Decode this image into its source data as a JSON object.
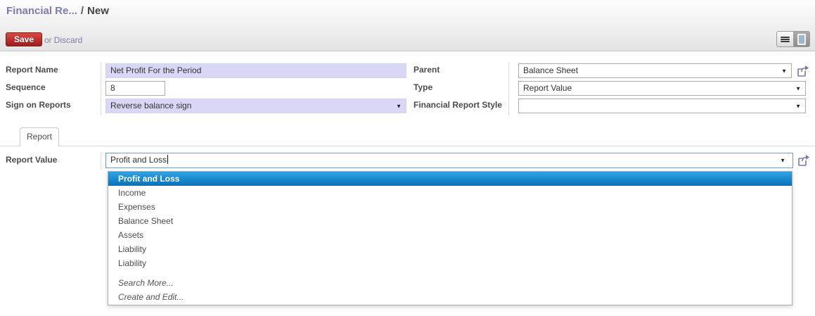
{
  "breadcrumb": {
    "parent": "Financial Re...",
    "separator": "/",
    "current": "New"
  },
  "statusbar": {
    "save_label": "Save",
    "or_label": "or",
    "discard_label": "Discard"
  },
  "view_switcher": {
    "list_tooltip": "List",
    "form_tooltip": "Form"
  },
  "icons": {
    "dropdown_arrow": "▼",
    "list_icon": "list-view",
    "form_icon": "form-view",
    "external_link": "external-link"
  },
  "form": {
    "left": {
      "report_name": {
        "label": "Report Name",
        "value": "Net Profit For the Period"
      },
      "sequence": {
        "label": "Sequence",
        "value": "8"
      },
      "sign_on_reports": {
        "label": "Sign on Reports",
        "value": "Reverse balance sign"
      }
    },
    "right": {
      "parent": {
        "label": "Parent",
        "value": "Balance Sheet"
      },
      "type": {
        "label": "Type",
        "value": "Report Value"
      },
      "financial_report_style": {
        "label": "Financial Report Style",
        "value": ""
      }
    },
    "tabs": [
      {
        "label": "Report",
        "active": true
      }
    ],
    "report_value": {
      "label": "Report Value",
      "value": "Profit and Loss"
    }
  },
  "dropdown": {
    "items": [
      {
        "label": "Profit and Loss",
        "highlighted": true
      },
      {
        "label": "Income",
        "highlighted": false
      },
      {
        "label": "Expenses",
        "highlighted": false
      },
      {
        "label": "Balance Sheet",
        "highlighted": false
      },
      {
        "label": "Assets",
        "highlighted": false
      },
      {
        "label": "Liability",
        "highlighted": false
      },
      {
        "label": "Liability",
        "highlighted": false
      }
    ],
    "actions": [
      {
        "label": "Search More..."
      },
      {
        "label": "Create and Edit..."
      }
    ]
  },
  "colors": {
    "accent_link": "#7c7bad",
    "save_button_red": "#b02025",
    "required_field_bg": "#d8d8f6",
    "highlight_blue_top": "#2fa3e6",
    "highlight_blue_bottom": "#0b70b6",
    "focused_input_border": "#6e9dc9",
    "header_gradient_bottom": "#e4e4e4"
  }
}
